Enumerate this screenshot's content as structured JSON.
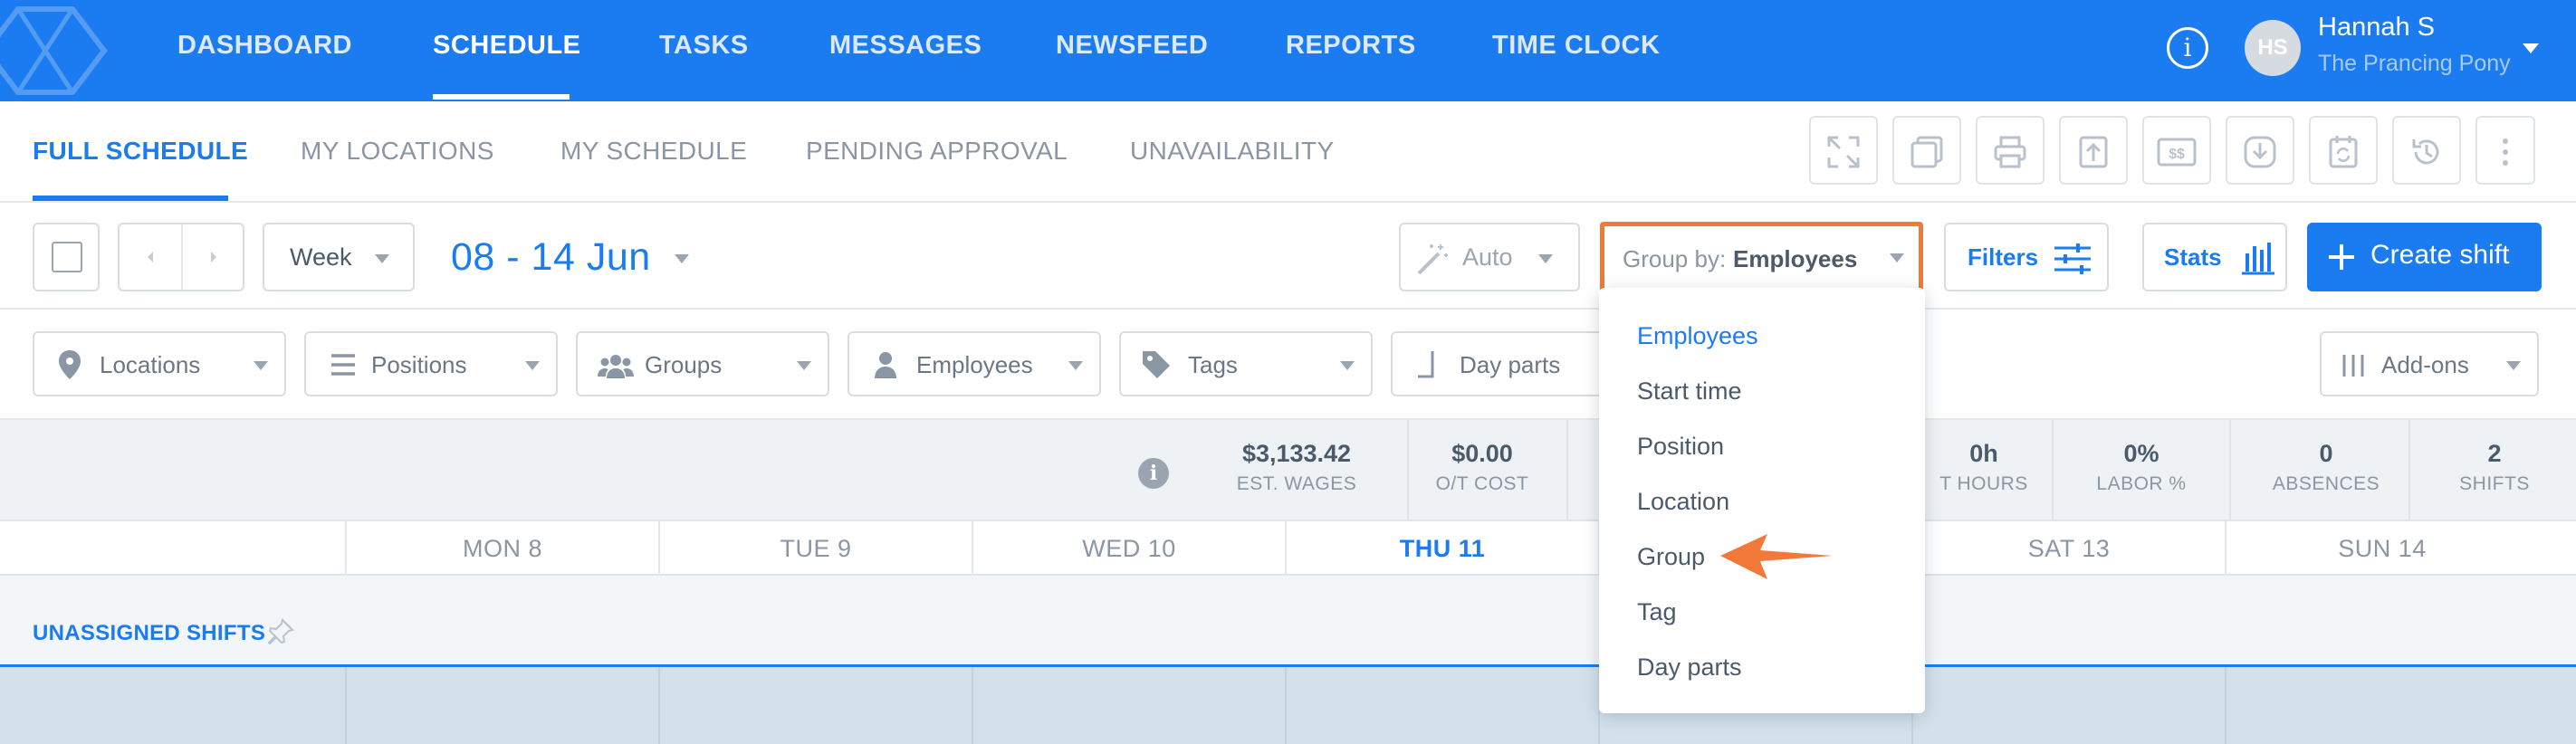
{
  "nav": {
    "items": [
      "DASHBOARD",
      "SCHEDULE",
      "TASKS",
      "MESSAGES",
      "NEWSFEED",
      "REPORTS",
      "TIME CLOCK"
    ],
    "user": {
      "initials": "HS",
      "name": "Hannah S",
      "org": "The Prancing Pony"
    }
  },
  "subtabs": [
    "FULL SCHEDULE",
    "MY LOCATIONS",
    "MY SCHEDULE",
    "PENDING APPROVAL",
    "UNAVAILABILITY"
  ],
  "toolbar": {
    "view": "Week",
    "date_range": "08 - 14 Jun",
    "auto": "Auto",
    "group_by_label": "Group by:",
    "group_by_value": "Employees",
    "filters": "Filters",
    "stats": "Stats",
    "create": "Create shift"
  },
  "filters": [
    "Locations",
    "Positions",
    "Groups",
    "Employees",
    "Tags",
    "Day parts"
  ],
  "addons": "Add-ons",
  "stats": [
    {
      "value": "$3,133.42",
      "label": "EST. WAGES"
    },
    {
      "value": "$0.00",
      "label": "O/T COST"
    },
    {
      "value": "0h",
      "label": "T HOURS"
    },
    {
      "value": "0%",
      "label": "LABOR %"
    },
    {
      "value": "0",
      "label": "ABSENCES"
    },
    {
      "value": "2",
      "label": "SHIFTS"
    }
  ],
  "days": [
    "MON 8",
    "TUE 9",
    "WED 10",
    "THU 11",
    "",
    "SAT 13",
    "SUN 14"
  ],
  "unassigned": "UNASSIGNED SHIFTS",
  "group_menu": [
    "Employees",
    "Start time",
    "Position",
    "Location",
    "Group",
    "Tag",
    "Day parts"
  ],
  "colors": {
    "brand": "#1b7bf0",
    "highlight": "#f2793a"
  }
}
